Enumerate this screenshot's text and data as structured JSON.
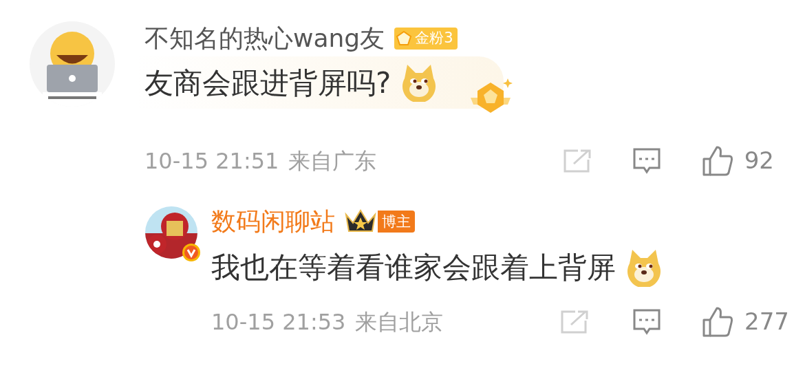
{
  "comments": [
    {
      "author": "不知名的热心wang友",
      "highlighted": false,
      "verified": false,
      "badge": {
        "kind": "fan",
        "label": "金粉3"
      },
      "text": "友商会跟进背屏吗?",
      "emoji": true,
      "bubble": true,
      "time": "10-15 21:51",
      "location": "来自广东",
      "likes": "92",
      "replies": [
        {
          "author": "数码闲聊站",
          "highlighted": true,
          "verified": true,
          "badge": {
            "kind": "blogger",
            "label": "博主"
          },
          "text": "我也在等着看谁家会跟着上背屏",
          "emoji": true,
          "bubble": false,
          "time": "10-15 21:53",
          "location": "来自北京",
          "likes": "277"
        }
      ]
    }
  ]
}
